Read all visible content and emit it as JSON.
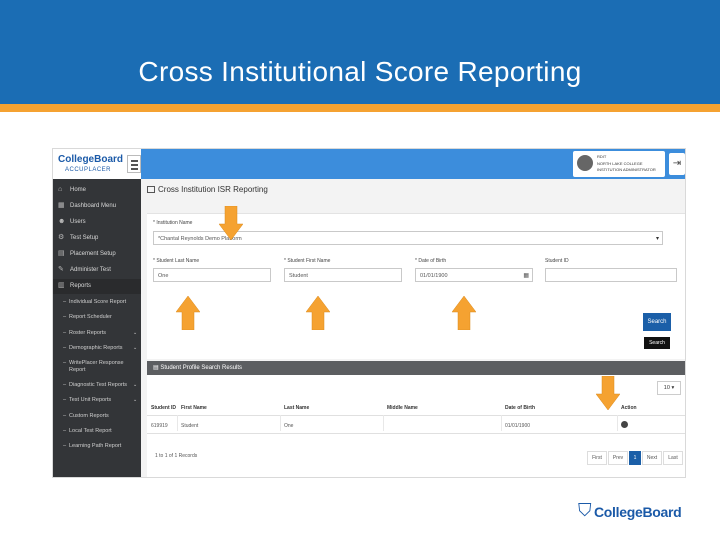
{
  "slide": {
    "title": "Cross Institutional Score Reporting",
    "colors": {
      "banner": "#1b6db4",
      "stripe": "#f5a231",
      "arrows": "#f5a231"
    }
  },
  "app": {
    "logo": {
      "brand": "CollegeBoard",
      "product": "ACCUPLACER"
    },
    "user": {
      "line1": "RDIT",
      "line2": "NORTH LAKE COLLEGE",
      "line3": "INSTITUTION ADMINISTRATOR"
    },
    "sidebar": {
      "items": [
        {
          "label": "Home",
          "icon": "home-icon"
        },
        {
          "label": "Dashboard Menu",
          "icon": "dashboard-icon"
        },
        {
          "label": "Users",
          "icon": "users-icon"
        },
        {
          "label": "Test Setup",
          "icon": "settings-icon"
        },
        {
          "label": "Placement Setup",
          "icon": "placement-icon"
        },
        {
          "label": "Administer Test",
          "icon": "edit-icon"
        },
        {
          "label": "Reports",
          "icon": "chart-icon"
        }
      ],
      "report_items": [
        {
          "label": "Individual Score Report"
        },
        {
          "label": "Report Scheduler"
        },
        {
          "label": "Roster Reports",
          "chevron": "⌄"
        },
        {
          "label": "Demographic Reports",
          "chevron": "⌄"
        },
        {
          "label": "WritePlacer Response"
        },
        {
          "label": "Report"
        },
        {
          "label": "Diagnostic Test Reports",
          "chevron": "⌄"
        },
        {
          "label": "Test Unit Reports",
          "chevron": "⌄"
        },
        {
          "label": "Custom Reports"
        },
        {
          "label": "Local Test Report"
        },
        {
          "label": "Learning Path Report"
        }
      ]
    },
    "page": {
      "title": "Cross Institution ISR Reporting",
      "form": {
        "institution_label": "* Institution Name",
        "institution_value": "*Chantal Reynolds Demo Platform",
        "last_name_label": "* Student Last Name",
        "last_name_value": "One",
        "first_name_label": "* Student First Name",
        "first_name_value": "Student",
        "dob_label": "* Date of Birth",
        "dob_value": "01/01/1900",
        "student_id_label": "Student ID",
        "student_id_value": "",
        "search_label": "Search",
        "tooltip": "Search"
      },
      "results": {
        "title": "Student Profile Search Results",
        "page_size": "10",
        "columns": [
          "Student ID",
          "First Name",
          "Last Name",
          "Middle Name",
          "Date of Birth",
          "Action"
        ],
        "rows": [
          [
            "619919",
            "Student",
            "One",
            "",
            "01/01/1900",
            ""
          ]
        ],
        "count_text": "1 to 1 of 1 Records",
        "pager": [
          "First",
          "Prev",
          "1",
          "Next",
          "Last"
        ]
      }
    }
  },
  "footer": {
    "brand": "CollegeBoard"
  }
}
